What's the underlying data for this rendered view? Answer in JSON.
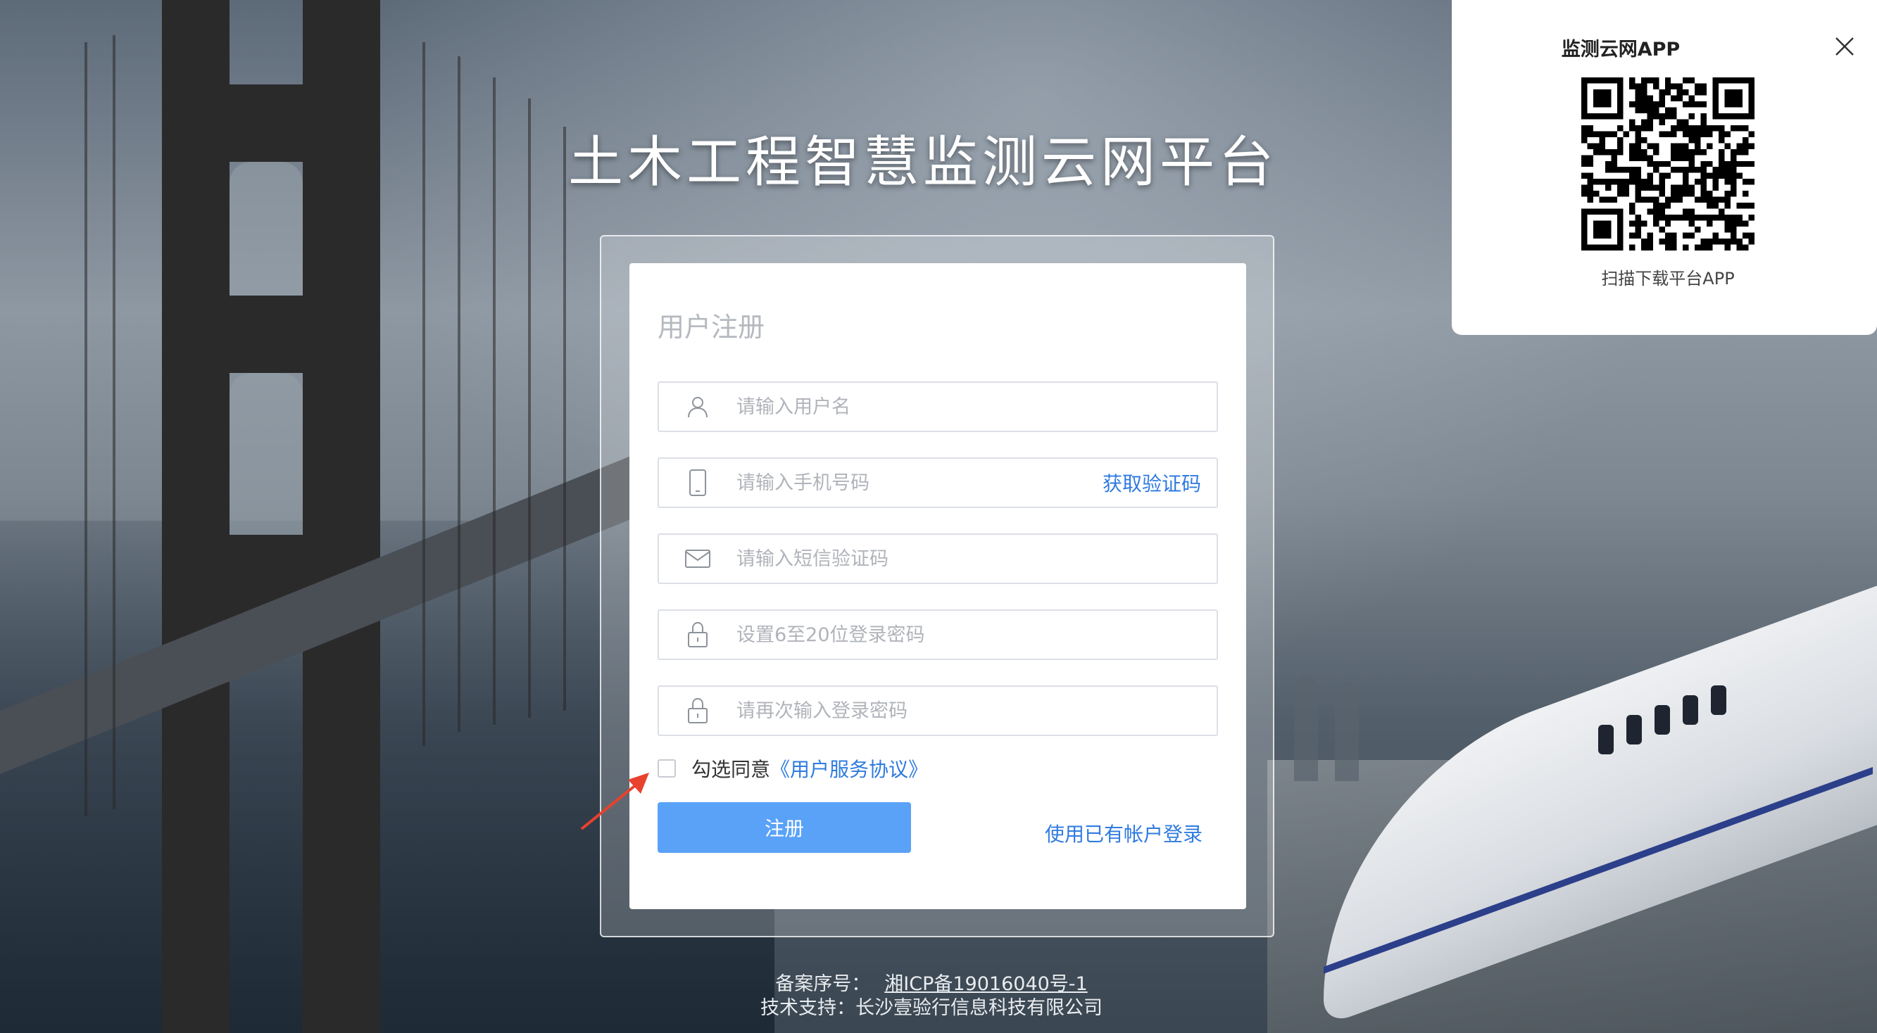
{
  "page": {
    "title": "土木工程智慧监测云网平台"
  },
  "register_form": {
    "heading": "用户注册",
    "username_placeholder": "请输入用户名",
    "phone_placeholder": "请输入手机号码",
    "get_code_label": "获取验证码",
    "sms_code_placeholder": "请输入短信验证码",
    "password_placeholder": "设置6至20位登录密码",
    "confirm_password_placeholder": "请再次输入登录密码",
    "agree_text": "勾选同意",
    "agreement_link": "《用户服务协议》",
    "agree_checked": false,
    "register_button": "注册",
    "login_link": "使用已有帐户登录"
  },
  "footer": {
    "icp_label": "备案序号：",
    "icp_number": "湘ICP备19016040号-1",
    "support": "技术支持：长沙壹验行信息科技有限公司"
  },
  "qr_panel": {
    "title": "监测云网APP",
    "caption": "扫描下载平台APP"
  },
  "icons": {
    "user": "user-icon",
    "phone": "phone-icon",
    "mail": "mail-icon",
    "lock": "lock-icon",
    "close": "close-icon",
    "arrow": "red-arrow-icon"
  },
  "colors": {
    "primary_button": "#5aa2f7",
    "link": "#2f7be0",
    "arrow": "#e8412e"
  }
}
